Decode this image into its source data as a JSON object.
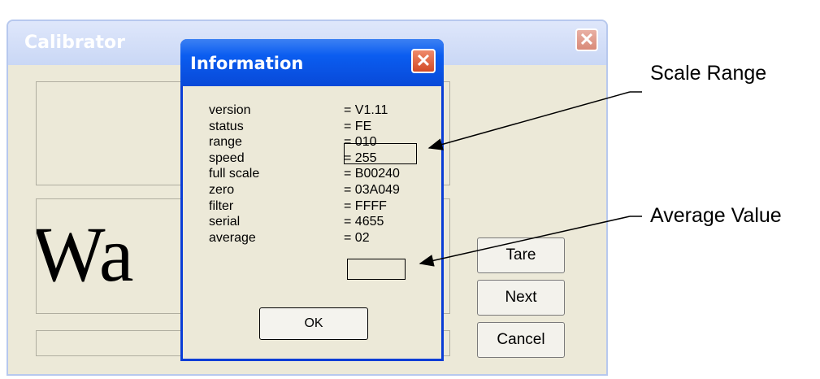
{
  "calibrator": {
    "title": "Calibrator",
    "close_glyph": "✕",
    "background_text": "Wa",
    "buttons": {
      "tare": "Tare",
      "next": "Next",
      "cancel": "Cancel"
    }
  },
  "info_dialog": {
    "title": "Information",
    "close_glyph": "✕",
    "rows": [
      {
        "label": "version",
        "value": "= V1.11"
      },
      {
        "label": "status",
        "value": "= FE"
      },
      {
        "label": "range",
        "value": "= 010"
      },
      {
        "label": "speed",
        "value": "= 255"
      },
      {
        "label": "full scale",
        "value": "= B00240"
      },
      {
        "label": "zero",
        "value": "= 03A049"
      },
      {
        "label": "filter",
        "value": "= FFFF"
      },
      {
        "label": "serial",
        "value": "= 4655"
      },
      {
        "label": "average",
        "value": "= 02"
      }
    ],
    "ok_label": "OK"
  },
  "annotations": {
    "scale_range": "Scale Range",
    "average_value": "Average Value"
  },
  "colors": {
    "dialog_title": "#0b5df0",
    "window_face": "#ece9d8",
    "close_red": "#d24a26"
  }
}
